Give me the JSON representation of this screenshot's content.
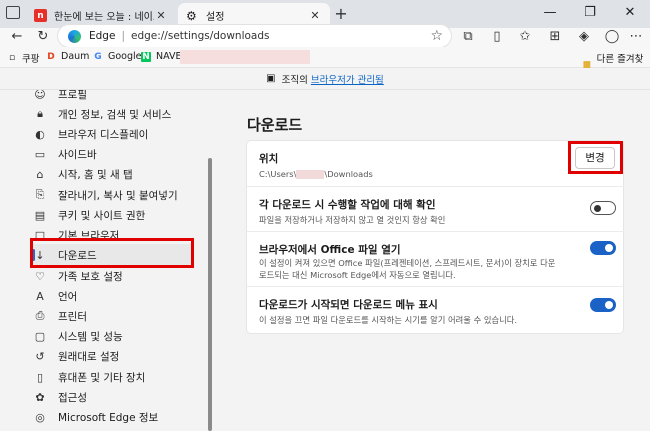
{
  "tabs": [
    {
      "title": "한눈에 보는 오늘 : 네이트",
      "favicon": "n"
    },
    {
      "title": "설정"
    }
  ],
  "toolbar": {
    "address_label": "Edge",
    "url": "edge://settings/downloads"
  },
  "favorites": [
    {
      "label": "쿠팡",
      "icon": "doc-icon"
    },
    {
      "label": "Daum",
      "icon": "daum-icon"
    },
    {
      "label": "Google",
      "icon": "google-icon"
    },
    {
      "label": "NAVER",
      "icon": "naver-icon"
    }
  ],
  "favorites_folder": "다른 즐겨찾기",
  "managed_banner": {
    "text": "조직의",
    "link": "브라우저가 관리됨"
  },
  "nav": [
    {
      "label": "프로필",
      "icon": "profile-icon"
    },
    {
      "label": "개인 정보, 검색 및 서비스",
      "icon": "lock-icon"
    },
    {
      "label": "브라우저 디스플레이",
      "icon": "appearance-icon"
    },
    {
      "label": "사이드바",
      "icon": "sidebar-icon"
    },
    {
      "label": "시작, 홈 및 새 탭",
      "icon": "home-icon"
    },
    {
      "label": "잘라내기, 복사 및 붙여넣기",
      "icon": "share-icon"
    },
    {
      "label": "쿠키 및 사이트 권한",
      "icon": "cookie-icon"
    },
    {
      "label": "기본 브라우저",
      "icon": "browser-icon"
    },
    {
      "label": "다운로드",
      "icon": "download-icon",
      "selected": true
    },
    {
      "label": "가족 보호 설정",
      "icon": "family-icon"
    },
    {
      "label": "언어",
      "icon": "language-icon"
    },
    {
      "label": "프린터",
      "icon": "printer-icon"
    },
    {
      "label": "시스템 및 성능",
      "icon": "system-icon"
    },
    {
      "label": "원래대로 설정",
      "icon": "reset-icon"
    },
    {
      "label": "휴대폰 및 기타 장치",
      "icon": "phone-icon"
    },
    {
      "label": "접근성",
      "icon": "accessibility-icon"
    },
    {
      "label": "Microsoft Edge 정보",
      "icon": "edge-icon"
    }
  ],
  "main": {
    "title": "다운로드",
    "location": {
      "title": "위치",
      "path_prefix": "C:\\Users\\",
      "path_suffix": "\\Downloads",
      "button": "변경"
    },
    "settings": [
      {
        "title": "각 다운로드 시 수행할 작업에 대해 확인",
        "desc": "파일을 저장하거나 저장하지 않고 열 것인지 항상 확인",
        "on": false
      },
      {
        "title": "브라우저에서 Office 파일 열기",
        "desc": "이 설정이 켜져 있으면 Office 파일(프레젠테이션, 스프레드시트, 문서)이 장치로 다운로드되는 대신 Microsoft Edge에서 자동으로 열립니다.",
        "on": true
      },
      {
        "title": "다운로드가 시작되면 다운로드 메뉴 표시",
        "desc": "이 설정을 끄면 파일 다운로드를 시작하는 시기를 알기 어려울 수 있습니다.",
        "on": true
      }
    ]
  }
}
